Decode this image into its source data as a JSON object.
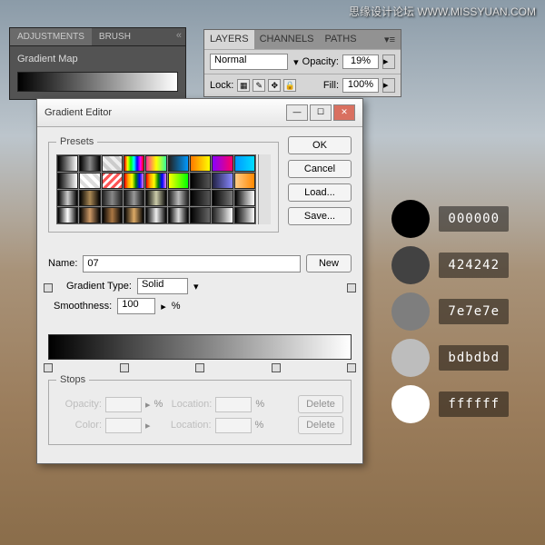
{
  "watermark": "思缘设计论坛  WWW.MISSYUAN.COM",
  "adjustments": {
    "tabs": [
      "ADJUSTMENTS",
      "BRUSH"
    ],
    "title": "Gradient Map"
  },
  "layers": {
    "tabs": [
      "LAYERS",
      "CHANNELS",
      "PATHS"
    ],
    "blend_mode": "Normal",
    "opacity_label": "Opacity:",
    "opacity_value": "19%",
    "lock_label": "Lock:",
    "fill_label": "Fill:",
    "fill_value": "100%"
  },
  "gradient_editor": {
    "title": "Gradient Editor",
    "presets_label": "Presets",
    "buttons": {
      "ok": "OK",
      "cancel": "Cancel",
      "load": "Load...",
      "save": "Save...",
      "new": "New"
    },
    "name_label": "Name:",
    "name_value": "07",
    "type_label": "Gradient Type:",
    "type_value": "Solid",
    "smoothness_label": "Smoothness:",
    "smoothness_value": "100",
    "percent": "%",
    "stops_label": "Stops",
    "opacity_label": "Opacity:",
    "location_label": "Location:",
    "color_label": "Color:",
    "delete": "Delete",
    "preset_gradients": [
      "linear-gradient(90deg,#000,#fff)",
      "linear-gradient(90deg,#000,#888,#000)",
      "repeating-linear-gradient(45deg,#eee 0 4px,#ccc 4px 8px)",
      "linear-gradient(90deg,#ff0000,#ffff00,#00ff00,#00ffff,#0000ff,#ff00ff,#ff0000)",
      "linear-gradient(90deg,#f39,#ff0,#3f9)",
      "linear-gradient(90deg,#222,#09f)",
      "linear-gradient(90deg,#f70,#ff0)",
      "linear-gradient(90deg,#80f,#f06)",
      "linear-gradient(90deg,#09f,#0df)",
      "linear-gradient(90deg,#000,#fff)",
      "repeating-linear-gradient(45deg,#fff 0 4px,#ddd 4px 8px)",
      "repeating-linear-gradient(-45deg,#f55 0 3px,#fff 3px 6px)",
      "linear-gradient(90deg,red,orange,yellow,green,blue,violet)",
      "linear-gradient(90deg,red,orange,yellow,green,blue,violet)",
      "linear-gradient(90deg,#ff0,#0f0)",
      "linear-gradient(90deg,#000,#555)",
      "linear-gradient(90deg,#224,#88f)",
      "linear-gradient(90deg,#fc8,#f80)",
      "linear-gradient(90deg,#000,#ccc,#000)",
      "linear-gradient(90deg,#000,#a85,#000)",
      "linear-gradient(90deg,#222,#888,#222)",
      "linear-gradient(90deg,#111,#999,#111)",
      "linear-gradient(90deg,#000,#cca,#000)",
      "linear-gradient(90deg,#222,#bbb,#222)",
      "linear-gradient(90deg,#000,#555)",
      "linear-gradient(90deg,#000,#777)",
      "linear-gradient(90deg,#000,#888,#fff)",
      "linear-gradient(90deg,#000,#fff,#000)",
      "linear-gradient(90deg,#000,#c96,#000)",
      "linear-gradient(90deg,#000,#a74,#000)",
      "linear-gradient(90deg,#000,#da6,#000)",
      "linear-gradient(90deg,#000,#eee,#000)",
      "linear-gradient(90deg,#000,#ddd,#000)",
      "linear-gradient(90deg,#000,#666)",
      "linear-gradient(90deg,#222,#888,#fff)",
      "linear-gradient(90deg,#000,#424242,#7e7e7e,#bdbdbd,#fff)"
    ],
    "bottom_stops_pct": [
      0,
      25,
      50,
      75,
      100
    ]
  },
  "swatches": [
    {
      "hex": "000000",
      "color": "#000000"
    },
    {
      "hex": "424242",
      "color": "#424242"
    },
    {
      "hex": "7e7e7e",
      "color": "#7e7e7e"
    },
    {
      "hex": "bdbdbd",
      "color": "#bdbdbd"
    },
    {
      "hex": "ffffff",
      "color": "#ffffff"
    }
  ]
}
